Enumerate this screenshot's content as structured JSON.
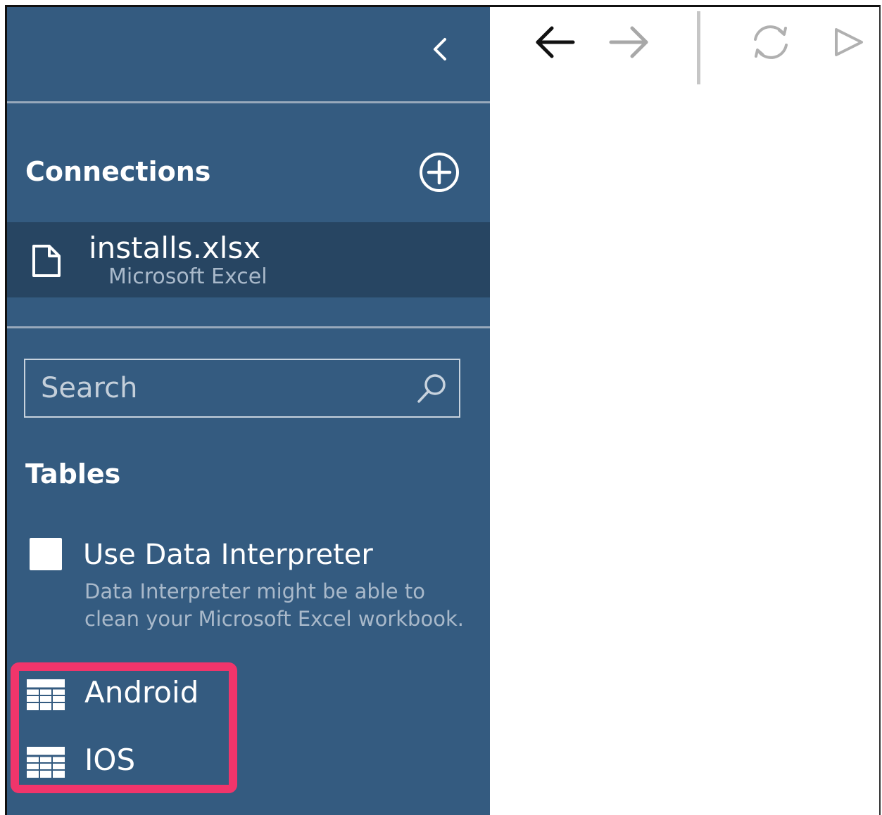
{
  "sidebar": {
    "connections_title": "Connections",
    "connection": {
      "name": "installs.xlsx",
      "type": "Microsoft Excel"
    },
    "search": {
      "placeholder": "Search",
      "value": ""
    },
    "tables_title": "Tables",
    "data_interpreter": {
      "label": "Use Data Interpreter",
      "description": "Data Interpreter might be able to clean your Microsoft Excel workbook.",
      "checked": false
    },
    "tables": [
      {
        "label": "Android",
        "icon": "table-icon"
      },
      {
        "label": "IOS",
        "icon": "table-icon"
      }
    ]
  },
  "toolbar": {
    "buttons": [
      {
        "icon": "arrow-left-icon",
        "enabled": true
      },
      {
        "icon": "arrow-right-icon",
        "enabled": false
      },
      {
        "icon": "refresh-icon",
        "enabled": false
      },
      {
        "icon": "play-icon",
        "enabled": false
      }
    ]
  },
  "colors": {
    "sidebar_bg": "#345b80",
    "selected_row_bg": "#274562",
    "highlight": "#f1356b"
  }
}
